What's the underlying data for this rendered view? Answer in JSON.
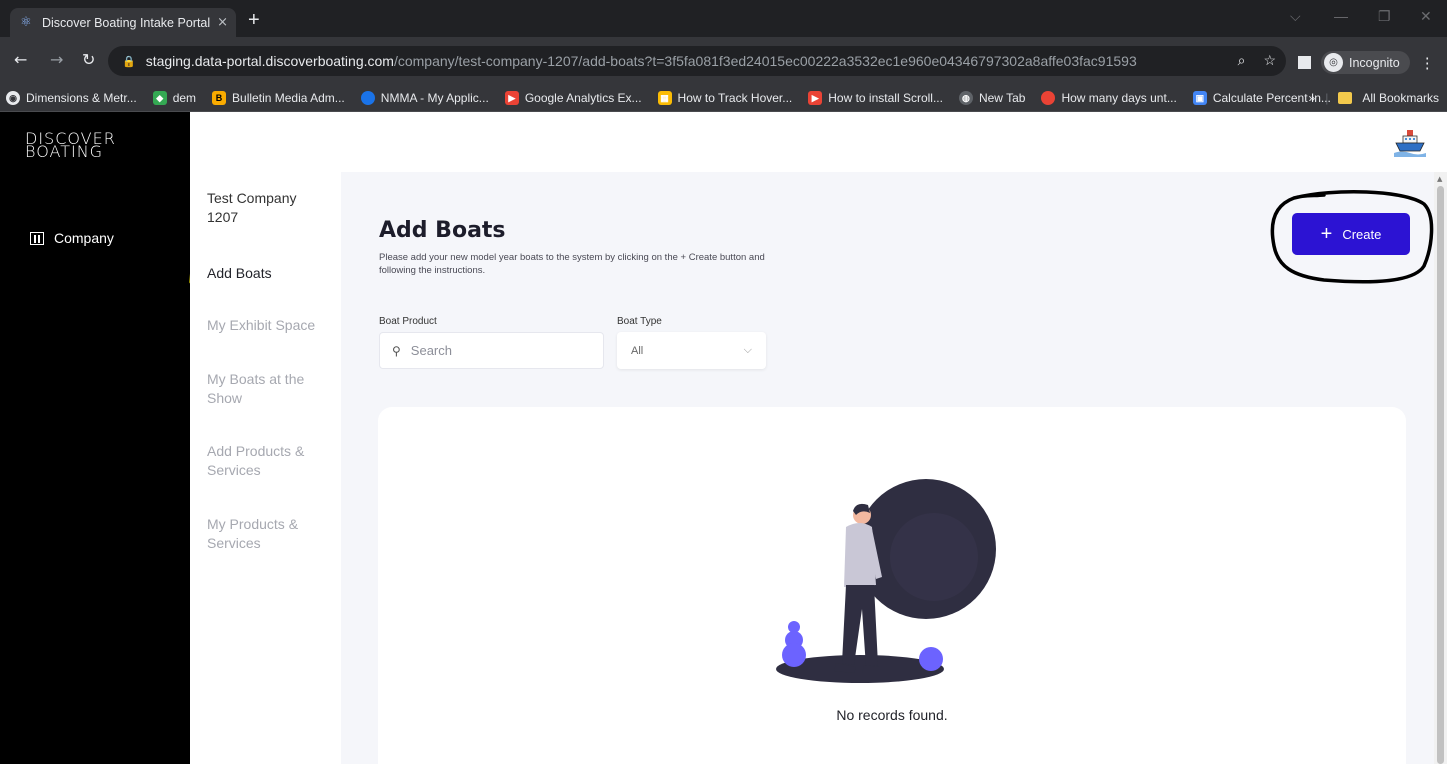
{
  "browser": {
    "tab_title": "Discover Boating Intake Portal",
    "tab_close": "×",
    "new_tab": "+",
    "url_host": "staging.data-portal.discoverboating.com",
    "url_path": "/company/test-company-1207/add-boats?t=3f5fa081f3ed24015ec00222a3532ec1e960e04346797302a8affe03fac91593",
    "incognito_label": "Incognito",
    "bookmarks": [
      {
        "label": "Dimensions & Metr...",
        "color": "#ffffff"
      },
      {
        "label": "dem",
        "color": "#34a853"
      },
      {
        "label": "Bulletin Media Adm...",
        "color": "#f9ab00"
      },
      {
        "label": "NMMA - My Applic...",
        "color": "#1a73e8"
      },
      {
        "label": "Google Analytics Ex...",
        "color": "#ea4335"
      },
      {
        "label": "How to Track Hover...",
        "color": "#fbbc04"
      },
      {
        "label": "How to install Scroll...",
        "color": "#ea4335"
      },
      {
        "label": "New Tab",
        "color": "#9aa0a6"
      },
      {
        "label": "How many days unt...",
        "color": "#ea4335"
      },
      {
        "label": "Calculate Percent In...",
        "color": "#4285f4"
      }
    ],
    "bookmarks_overflow": "»",
    "all_bookmarks": "All Bookmarks"
  },
  "app": {
    "logo_line1": "DISCOVER",
    "logo_line2": "BOATING",
    "sidebar_company": "Company"
  },
  "subnav": {
    "company_name": "Test Company 1207",
    "items": [
      "Add Boats",
      "My Exhibit Space",
      "My Boats at the Show",
      "Add Products & Services",
      "My Products & Services"
    ],
    "active_index": 0
  },
  "main": {
    "title": "Add Boats",
    "description": "Please add your new model year boats to the system by clicking on the + Create button and following the instructions.",
    "create_plus": "+",
    "create_label": "Create",
    "filter_product_label": "Boat Product",
    "search_placeholder": "Search",
    "filter_type_label": "Boat Type",
    "type_value": "All",
    "empty_text": "No records found."
  },
  "colors": {
    "primary": "#2c13d3",
    "highlight": "#fff200",
    "sidebar_bg": "#000000",
    "illustration_dark": "#2f2e41",
    "illustration_accent": "#6c63ff"
  }
}
